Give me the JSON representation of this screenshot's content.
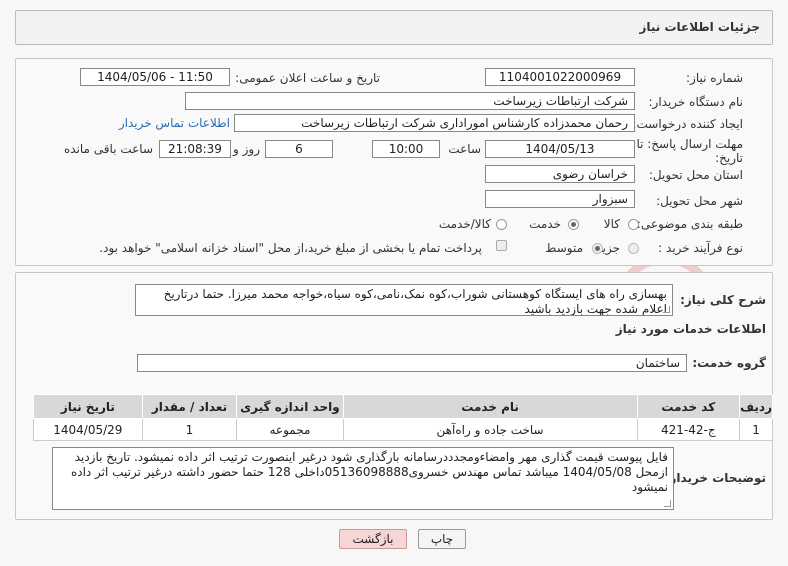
{
  "header": {
    "title": "جزئیات اطلاعات نیاز"
  },
  "form": {
    "need_number_label": "شماره نیاز:",
    "need_number": "1104001022000969",
    "announce_label": "تاریخ و ساعت اعلان عمومی:",
    "announce_value": "1404/05/06 - 11:50",
    "buyer_org_label": "نام دستگاه خریدار:",
    "buyer_org": "شرکت ارتباطات زیرساخت",
    "creator_label": "ایجاد کننده درخواست:",
    "creator": "رحمان محمدزاده کارشناس اموراداری  شرکت ارتباطات زیرساخت",
    "contact_link": "اطلاعات تماس خریدار",
    "deadline_label": "مهلت ارسال پاسخ: تا",
    "deadline_label2": "تاریخ:",
    "deadline_date": "1404/05/13",
    "time_label": "ساعت",
    "deadline_time": "10:00",
    "days": "6",
    "days_label": "روز و",
    "remaining": "21:08:39",
    "remaining_label": "ساعت باقی مانده",
    "province_label": "استان محل تحویل:",
    "province": "خراسان رضوی",
    "city_label": "شهر محل تحویل:",
    "city": "سبزوار",
    "category_label": "طبقه بندی موضوعی:",
    "category_options": [
      "کالا",
      "خدمت",
      "کالا/خدمت"
    ],
    "category_selected": "خدمت",
    "process_label": "نوع فرآیند خرید :",
    "process_options": [
      "جزیی",
      "متوسط"
    ],
    "process_selected": "متوسط",
    "payment_note": "پرداخت تمام یا بخشی از مبلغ خرید،از محل \"اسناد خزانه اسلامی\" خواهد بود."
  },
  "details": {
    "summary_label": "شرح کلی نیاز:",
    "summary": "بهسازی راه های ایستگاه کوهستانی شوراب،کوه نمک،نامی،کوه سیاه،خواجه محمد میرزا. حتما درتاریخ اعلام شده جهت بازدید باشید",
    "services_title": "اطلاعات خدمات مورد نیاز",
    "service_group_label": "گروه خدمت:",
    "service_group": "ساختمان",
    "table": {
      "headers": [
        "ردیف",
        "کد خدمت",
        "نام خدمت",
        "واحد اندازه گیری",
        "تعداد / مقدار",
        "تاریخ نیاز"
      ],
      "rows": [
        [
          "1",
          "ج-42-421",
          "ساخت جاده و راه‌آهن",
          "مجموعه",
          "1",
          "1404/05/29"
        ]
      ]
    },
    "buyer_notes_label": "توضیحات خریدار:",
    "buyer_notes": "فایل پیوست قیمت گذاری مهر وامضاءومجدددرسامانه بارگذاری شود درغیر اینصورت ترتیب اثر داده نمیشود. تاریخ بازدید ازمحل 1404/05/08 میباشد تماس مهندس خسروی05136098888داخلی 128 حتما حضور داشته درغیر ترتیب اثر داده نمیشود"
  },
  "buttons": {
    "print": "چاپ",
    "back": "بازگشت"
  },
  "watermark": {
    "text": "AriaTender.neT"
  },
  "colors": {
    "link": "#2a6db5",
    "back_button": "#f6d5d5",
    "watermark": "#d9534f"
  }
}
